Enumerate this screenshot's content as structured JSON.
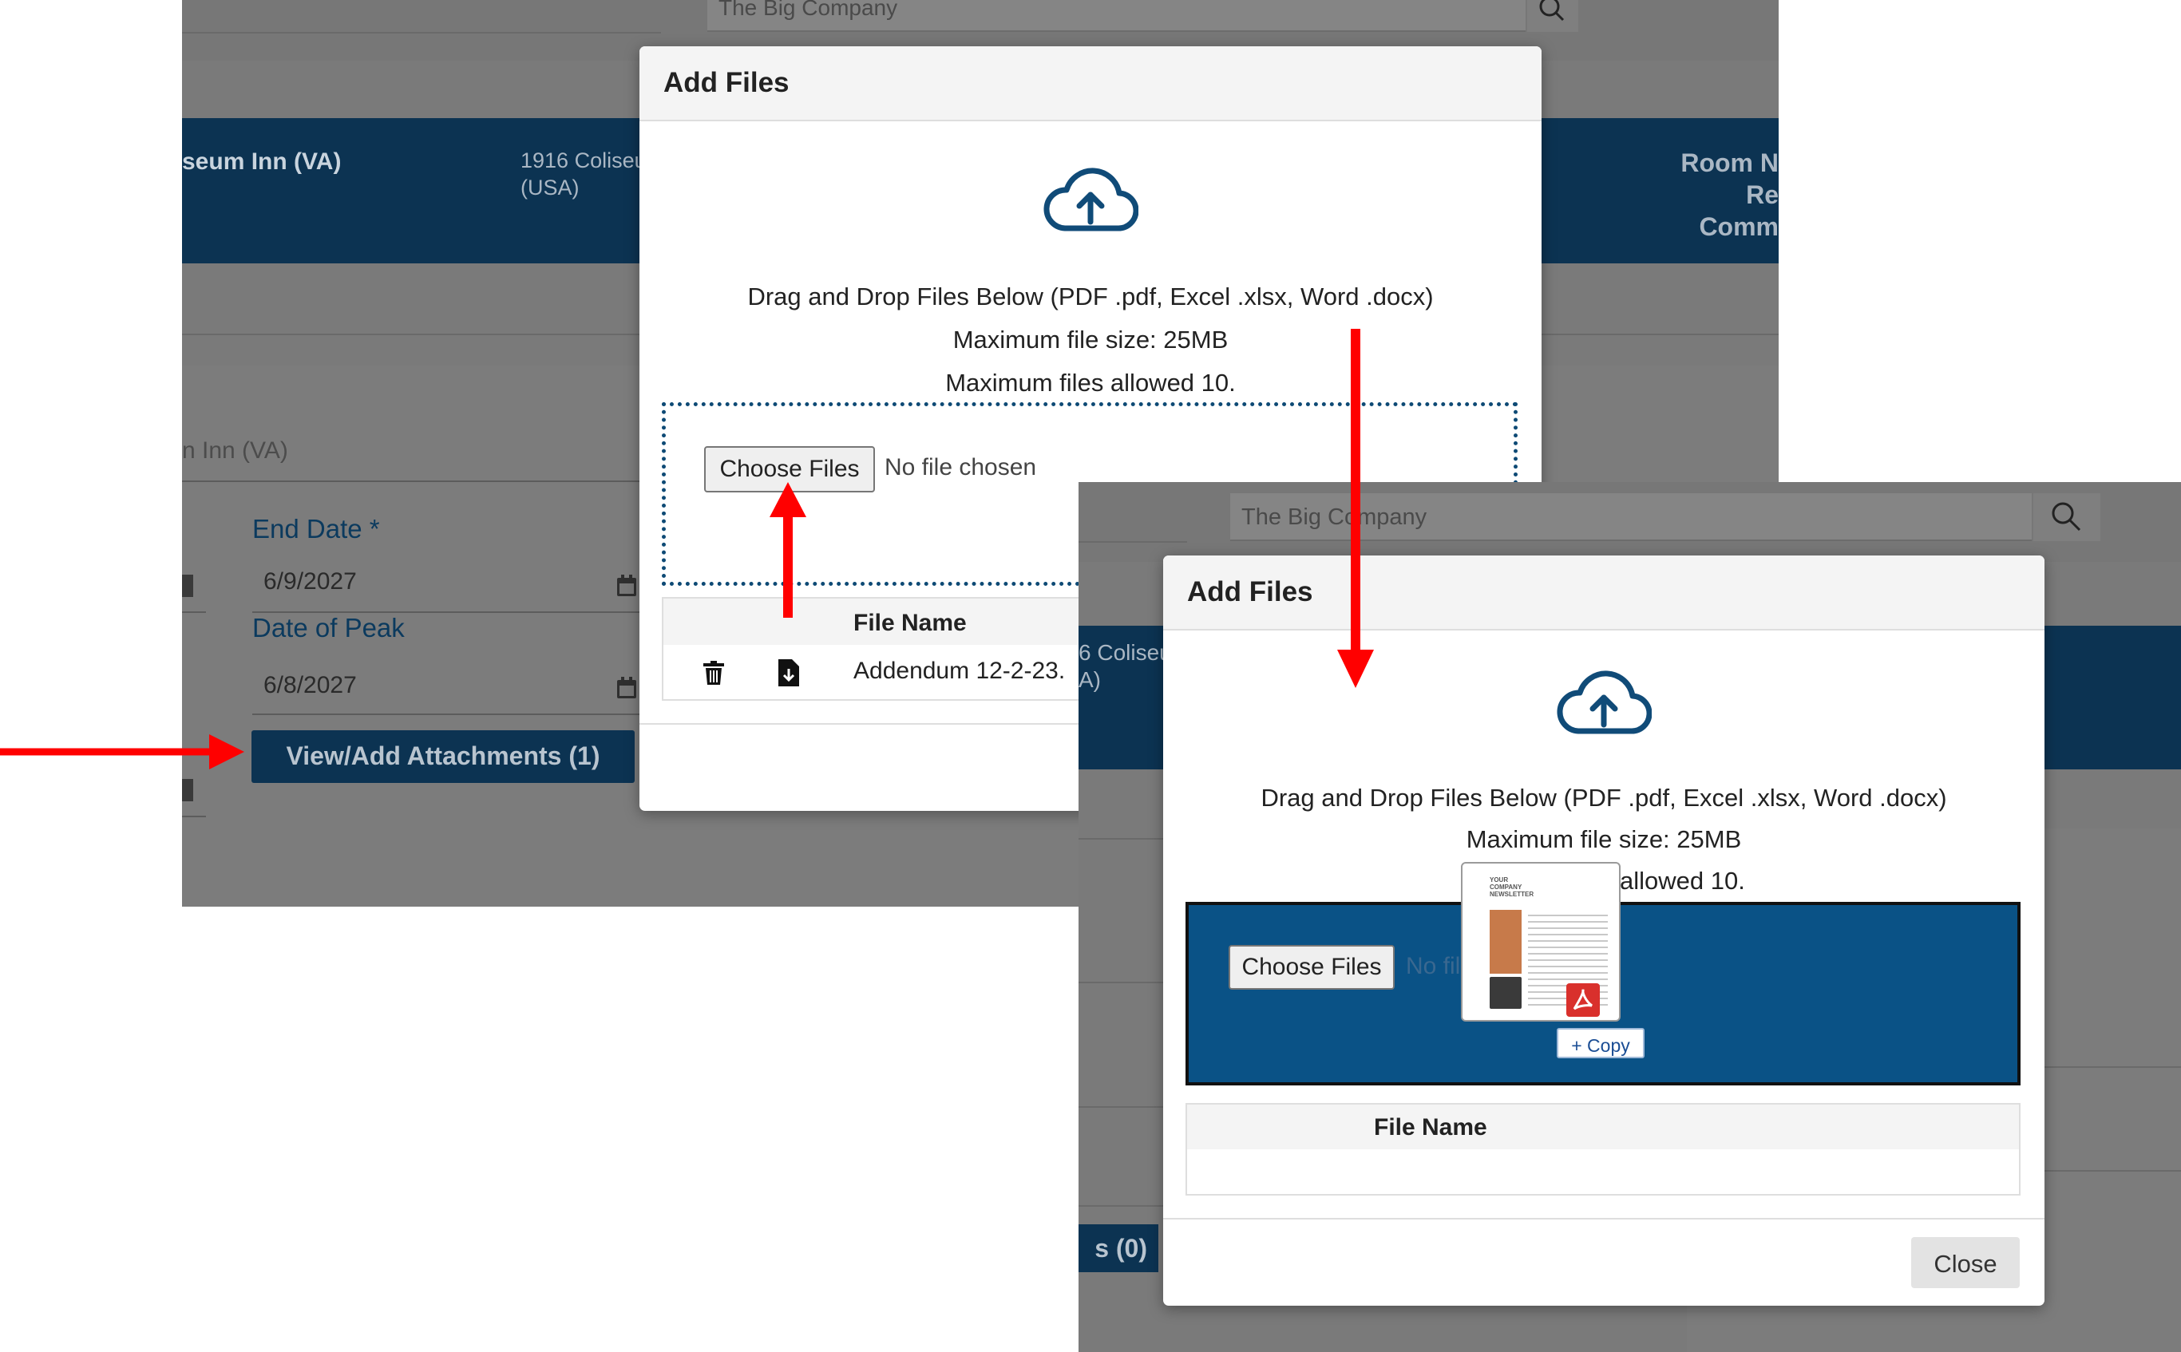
{
  "colors": {
    "overlay_grey": "#7a7a7a",
    "dark_band": "#0c3352",
    "drop_active": "#0a5286",
    "accent_blue": "#104b78",
    "arrow_red": "#ff0000"
  },
  "back_screen": {
    "search_placeholder": "The Big Company",
    "hotel_name": "seum Inn (VA)",
    "hotel_address_line1": "1916 Coliseu",
    "hotel_address_line2": "(USA)",
    "room_label_1": "Room N",
    "room_label_2": "Re",
    "room_label_3": "Comm",
    "property_field_value": "n Inn (VA)",
    "end_date_label": "End Date *",
    "end_date_value": "6/9/2027",
    "date_of_peak_label": "Date of Peak",
    "date_of_peak_value": "6/8/2027",
    "attachments_button": "View/Add Attachments (1)"
  },
  "modal_1": {
    "title": "Add Files",
    "drag_text": "Drag and Drop Files Below (PDF .pdf, Excel .xlsx, Word .docx)",
    "max_size_text": "Maximum file size: 25MB",
    "max_files_text": "Maximum files allowed 10.",
    "choose_files": "Choose Files",
    "no_file": "No file chosen",
    "table_header": "File Name",
    "file_row_name": "Addendum 12-2-23."
  },
  "front_screen": {
    "search_placeholder": "The Big Company",
    "partial_address_1": "6 Coliseu",
    "partial_address_2": "A)",
    "partial_button": "s (0)"
  },
  "modal_2": {
    "title": "Add Files",
    "drag_text": "Drag and Drop Files Below (PDF .pdf, Excel .xlsx, Word .docx)",
    "max_size_text": "Maximum file size: 25MB",
    "max_files_text_visible": "allowed 10.",
    "choose_files": "Choose Files",
    "no_file_partial": "No fil",
    "copy_badge": "+ Copy",
    "table_header": "File Name",
    "close_button": "Close"
  },
  "drag_thumbnail": {
    "line1": "YOUR",
    "line2": "COMPANY",
    "line3": "NEWSLETTER"
  }
}
